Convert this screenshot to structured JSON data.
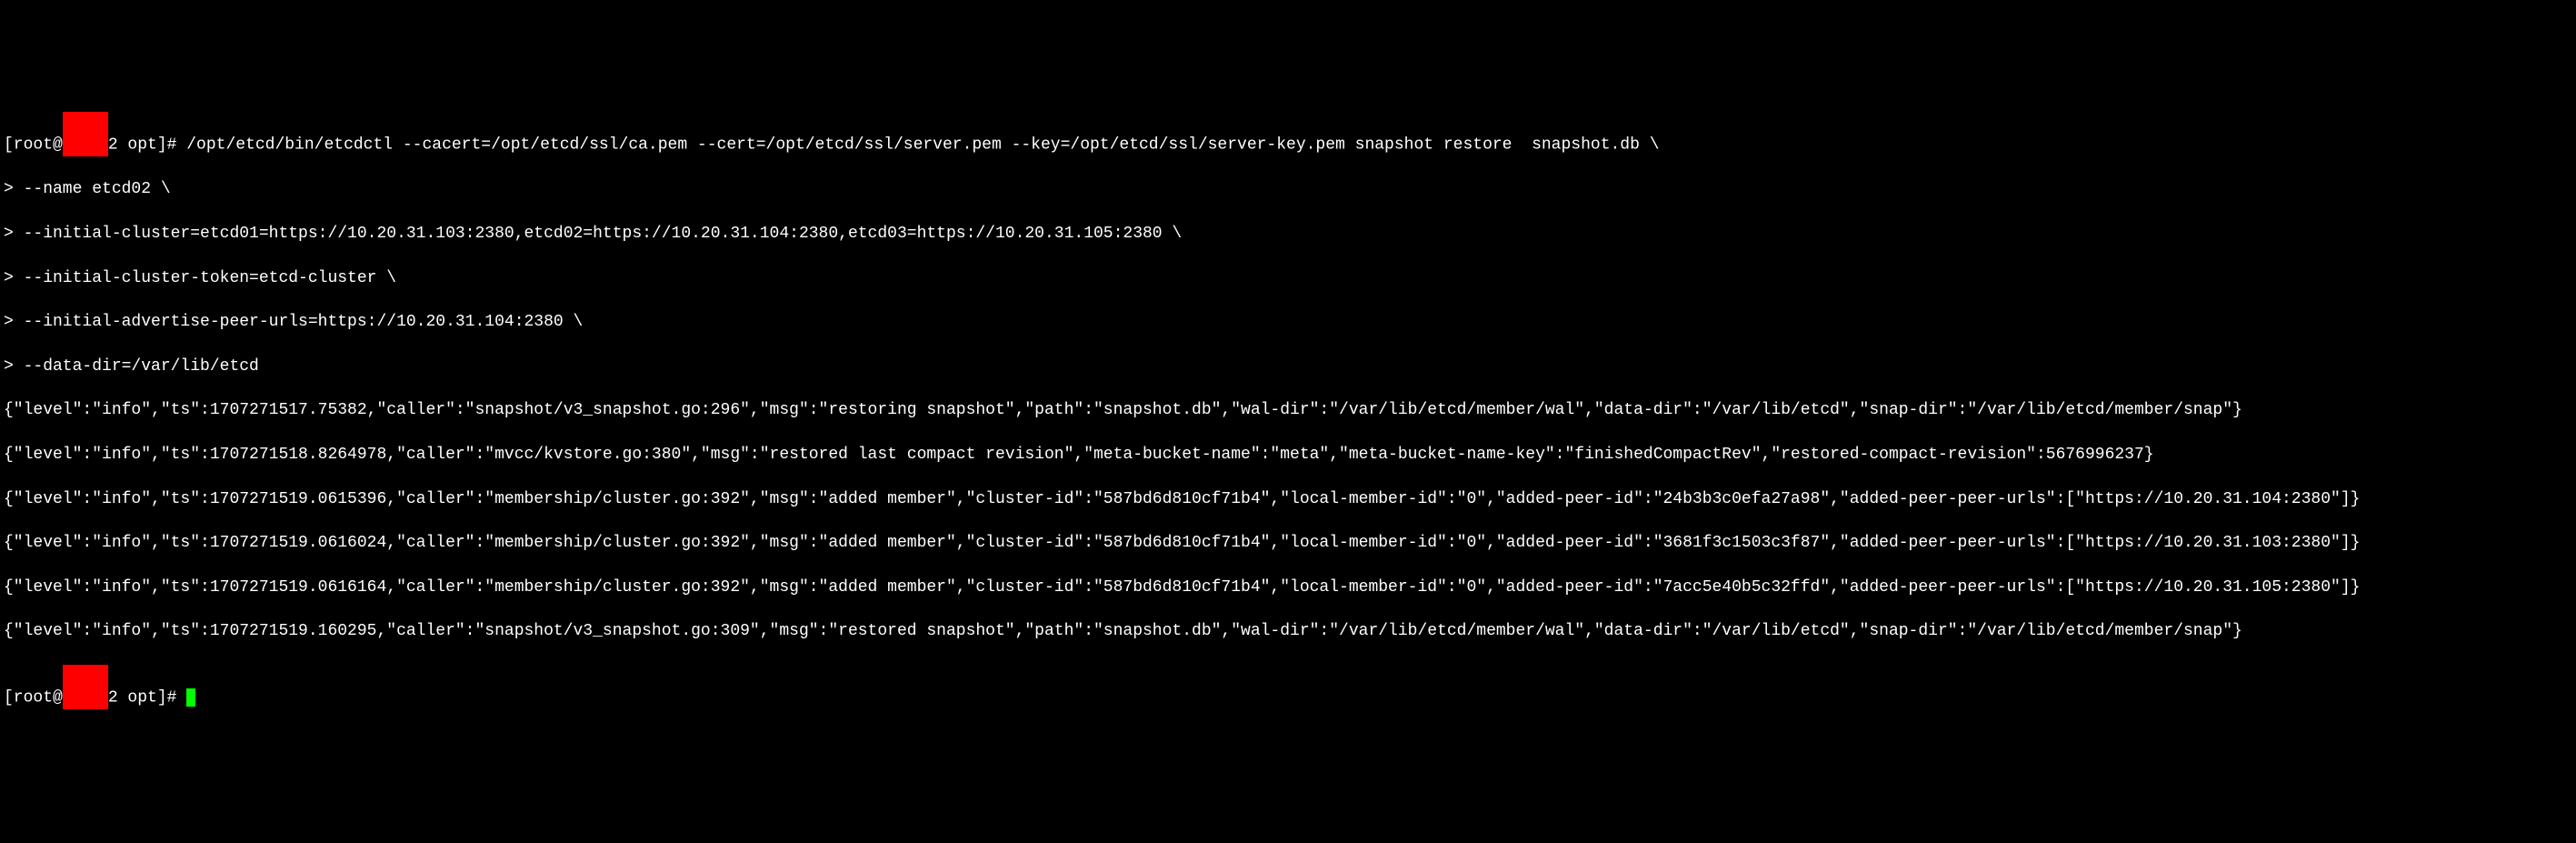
{
  "terminal": {
    "prompt_prefix": "[root@",
    "prompt_redacted": "xxxxx",
    "prompt_suffix": "2 opt]# ",
    "command1": "/opt/etcd/bin/etcdctl --cacert=/opt/etcd/ssl/ca.pem --cert=/opt/etcd/ssl/server.pem --key=/opt/etcd/ssl/server-key.pem snapshot restore  snapshot.db \\",
    "cont1": "> --name etcd02 \\",
    "cont2": "> --initial-cluster=etcd01=https://10.20.31.103:2380,etcd02=https://10.20.31.104:2380,etcd03=https://10.20.31.105:2380 \\",
    "cont3": "> --initial-cluster-token=etcd-cluster \\",
    "cont4": "> --initial-advertise-peer-urls=https://10.20.31.104:2380 \\",
    "cont5": "> --data-dir=/var/lib/etcd",
    "log1": "{\"level\":\"info\",\"ts\":1707271517.75382,\"caller\":\"snapshot/v3_snapshot.go:296\",\"msg\":\"restoring snapshot\",\"path\":\"snapshot.db\",\"wal-dir\":\"/var/lib/etcd/member/wal\",\"data-dir\":\"/var/lib/etcd\",\"snap-dir\":\"/var/lib/etcd/member/snap\"}",
    "log2": "{\"level\":\"info\",\"ts\":1707271518.8264978,\"caller\":\"mvcc/kvstore.go:380\",\"msg\":\"restored last compact revision\",\"meta-bucket-name\":\"meta\",\"meta-bucket-name-key\":\"finishedCompactRev\",\"restored-compact-revision\":5676996237}",
    "log3": "{\"level\":\"info\",\"ts\":1707271519.0615396,\"caller\":\"membership/cluster.go:392\",\"msg\":\"added member\",\"cluster-id\":\"587bd6d810cf71b4\",\"local-member-id\":\"0\",\"added-peer-id\":\"24b3b3c0efa27a98\",\"added-peer-peer-urls\":[\"https://10.20.31.104:2380\"]}",
    "log4": "{\"level\":\"info\",\"ts\":1707271519.0616024,\"caller\":\"membership/cluster.go:392\",\"msg\":\"added member\",\"cluster-id\":\"587bd6d810cf71b4\",\"local-member-id\":\"0\",\"added-peer-id\":\"3681f3c1503c3f87\",\"added-peer-peer-urls\":[\"https://10.20.31.103:2380\"]}",
    "log5": "{\"level\":\"info\",\"ts\":1707271519.0616164,\"caller\":\"membership/cluster.go:392\",\"msg\":\"added member\",\"cluster-id\":\"587bd6d810cf71b4\",\"local-member-id\":\"0\",\"added-peer-id\":\"7acc5e40b5c32ffd\",\"added-peer-peer-urls\":[\"https://10.20.31.105:2380\"]}",
    "log6": "{\"level\":\"info\",\"ts\":1707271519.160295,\"caller\":\"snapshot/v3_snapshot.go:309\",\"msg\":\"restored snapshot\",\"path\":\"snapshot.db\",\"wal-dir\":\"/var/lib/etcd/member/wal\",\"data-dir\":\"/var/lib/etcd\",\"snap-dir\":\"/var/lib/etcd/member/snap\"}",
    "prompt2_prefix": "[root@",
    "prompt2_suffix": "2 opt]# "
  }
}
